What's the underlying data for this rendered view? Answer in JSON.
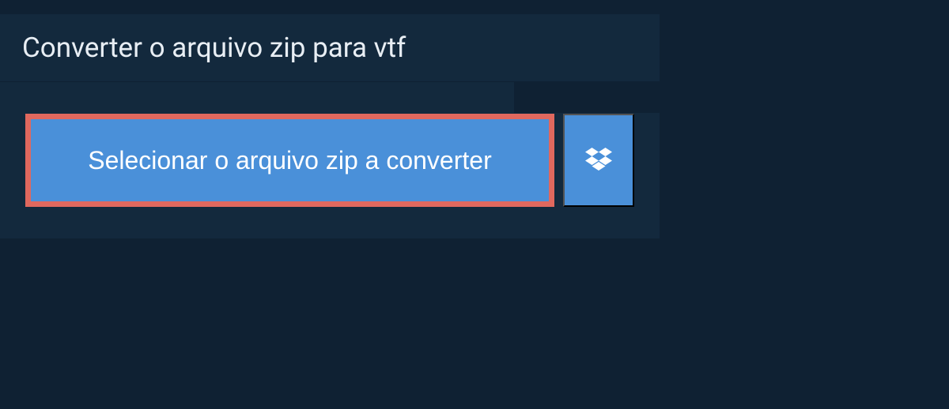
{
  "header": {
    "title": "Converter o arquivo zip para vtf"
  },
  "actions": {
    "select_file_label": "Selecionar o arquivo zip a converter"
  },
  "colors": {
    "primary": "#4a90d9",
    "highlight": "#e0685e",
    "background": "#0f2133",
    "panel": "#13293d"
  }
}
